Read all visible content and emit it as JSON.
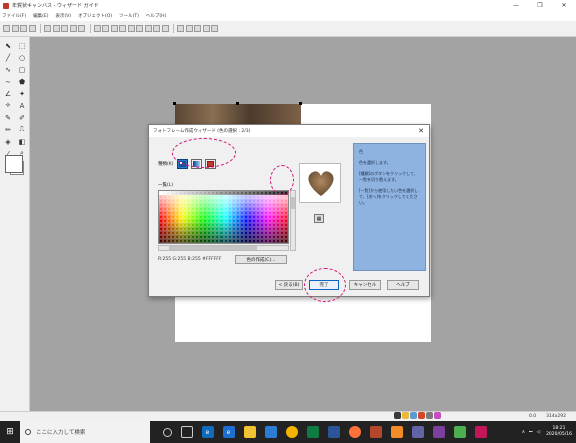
{
  "window": {
    "title": "年賀状キャンバス - ウィザード ガイド",
    "controls": [
      "—",
      "❐",
      "✕"
    ]
  },
  "menu": [
    "ファイル(F)",
    "編集(E)",
    "表示(V)",
    "オブジェクト(O)",
    "ツール(T)",
    "ヘルプ(H)"
  ],
  "dialog": {
    "title": "フォトフレーム作成ウィザード (色の選択 : 2/3)",
    "close": "✕",
    "kind_label": "種類(K)",
    "list_label": "一覧(L)",
    "rgb_text": "R:255 G:255 B:255  #FFFFFF",
    "custom_button": "色の作成(C)...",
    "help": {
      "title": "色",
      "line1": "色を選択します。",
      "line2": "[種類]のボタンをクリックして、一覧を切り替えます。",
      "line3": "[一覧]から使用したい色を選択して、[次へ]をクリックしてください。"
    },
    "buttons": {
      "back": "< 戻る(B)",
      "finish": "完了",
      "cancel": "キャンセル",
      "help": "ヘルプ"
    }
  },
  "status": {
    "zoom": "0.0",
    "size": "314x292"
  },
  "taskbar": {
    "search_placeholder": "ここに入力して検索",
    "time": "18:21",
    "date": "2020/05/16"
  },
  "colors": {
    "annotation": "#d2137a",
    "help_panel": "#8eb3e0",
    "selected_kind": "#2a76c9"
  }
}
